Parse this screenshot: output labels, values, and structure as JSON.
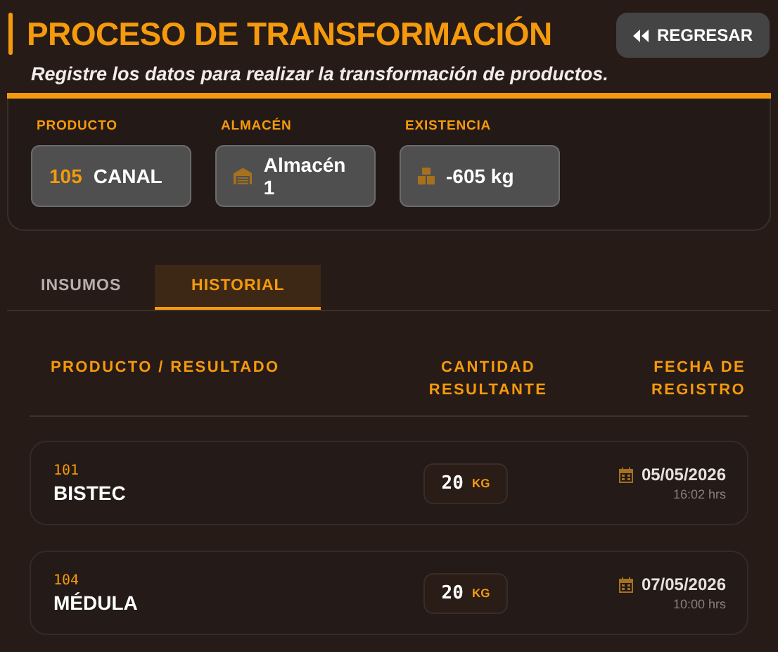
{
  "header": {
    "title": "PROCESO DE TRANSFORMACIÓN",
    "subtitle": "Registre los datos para realizar la transformación de productos.",
    "back_button": "REGRESAR"
  },
  "fields": [
    {
      "kind": "product",
      "label": "PRODUCTO",
      "code": "105",
      "value": "CANAL"
    },
    {
      "kind": "warehouse",
      "label": "ALMACÉN",
      "value": "Almacén 1"
    },
    {
      "kind": "stock",
      "label": "EXISTENCIA",
      "value": "-605 kg"
    }
  ],
  "tabs": [
    {
      "label": "INSUMOS",
      "selected": false
    },
    {
      "label": "HISTORIAL",
      "selected": true
    }
  ],
  "table": {
    "columns": [
      "PRODUCTO / RESULTADO",
      "CANTIDAD RESULTANTE",
      "FECHA DE REGISTRO"
    ],
    "rows": [
      {
        "code": "101",
        "name": "BISTEC",
        "quantity": "20",
        "unit": "KG",
        "date": "05/05/2026",
        "time": "16:02 hrs"
      },
      {
        "code": "104",
        "name": "MÉDULA",
        "quantity": "20",
        "unit": "KG",
        "date": "07/05/2026",
        "time": "10:00 hrs"
      }
    ]
  }
}
